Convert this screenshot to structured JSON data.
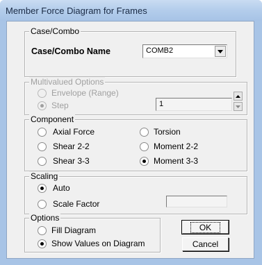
{
  "window": {
    "title": "Member Force Diagram for Frames"
  },
  "case_combo": {
    "legend": "Case/Combo",
    "name_label": "Case/Combo Name",
    "selected": "COMB2"
  },
  "multivalued": {
    "legend": "Multivalued Options",
    "envelope_label": "Envelope (Range)",
    "step_label": "Step",
    "step_value": "1"
  },
  "component": {
    "legend": "Component",
    "axial": "Axial Force",
    "torsion": "Torsion",
    "shear22": "Shear 2-2",
    "moment22": "Moment 2-2",
    "shear33": "Shear 3-3",
    "moment33": "Moment 3-3",
    "selected": "Moment 3-3"
  },
  "scaling": {
    "legend": "Scaling",
    "auto": "Auto",
    "scale_factor": "Scale Factor",
    "scale_value": "",
    "selected": "Auto"
  },
  "options": {
    "legend": "Options",
    "fill": "Fill Diagram",
    "show_values": "Show Values on Diagram",
    "selected": "Show Values on Diagram"
  },
  "buttons": {
    "ok": "OK",
    "cancel": "Cancel"
  },
  "icons": {
    "combo_arrow": "chevron-down-icon",
    "spin_up": "spin-up-icon",
    "spin_down": "spin-down-icon"
  }
}
